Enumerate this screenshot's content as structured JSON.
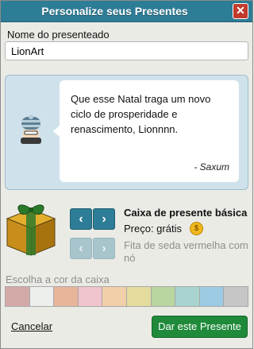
{
  "window": {
    "title": "Personalize seus Presentes",
    "close_glyph": "✕"
  },
  "recipient": {
    "label": "Nome do presenteado",
    "value": "LionArt"
  },
  "message": {
    "text": "Que esse Natal traga um novo\nciclo de prosperidade e\nrenascimento, Lionnnn.",
    "signature": "- Saxum",
    "avatar_icon": "beanie-avatar-icon"
  },
  "box": {
    "prev_glyph": "‹",
    "next_glyph": "›",
    "name": "Caixa de presente básica",
    "price_label": "Preço: grátis",
    "coin_icon": "credit-coin-icon",
    "ribbon": "Fita de seda vermelha com nó"
  },
  "color_picker": {
    "label": "Escolha a cor da caixa",
    "colors": [
      "#d4aaa8",
      "#ecefeb",
      "#e7b59a",
      "#f0c4cc",
      "#f1cfa8",
      "#e3dc9c",
      "#b9d6a0",
      "#a8d3cf",
      "#9dcbe4",
      "#c6c6c6"
    ]
  },
  "footer": {
    "cancel_label": "Cancelar",
    "submit_label": "Dar este Presente"
  }
}
